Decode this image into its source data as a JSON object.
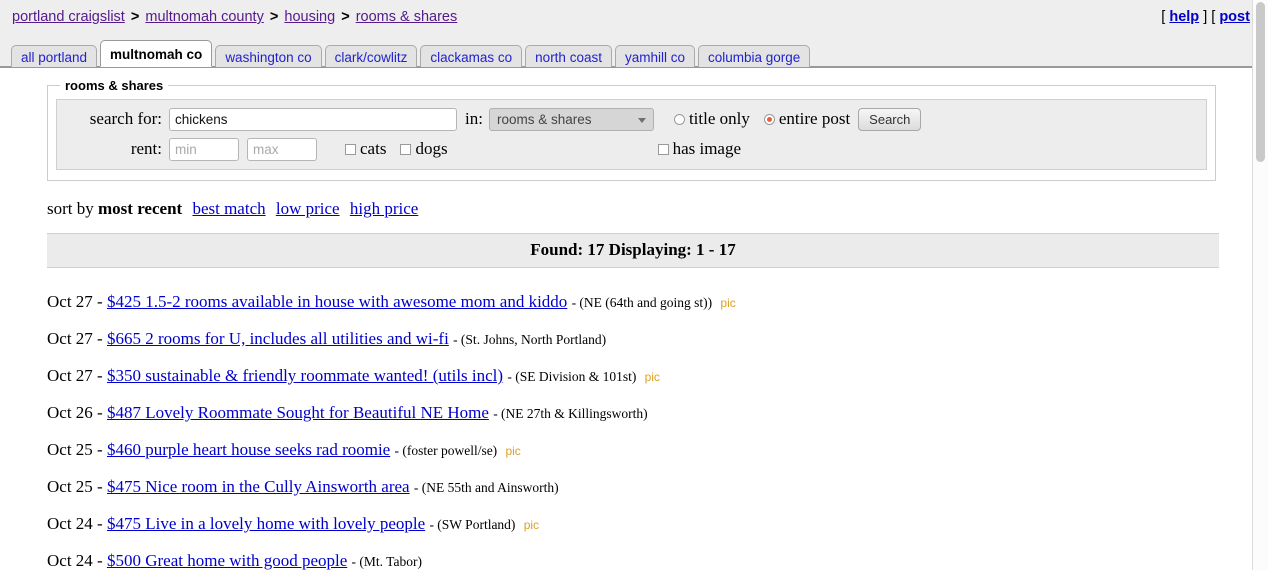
{
  "header": {
    "breadcrumb": [
      {
        "label": "portland craigslist"
      },
      {
        "label": "multnomah county"
      },
      {
        "label": "housing"
      },
      {
        "label": "rooms & shares"
      }
    ],
    "separator": ">",
    "links": {
      "open_bracket": "[",
      "close_bracket": "]",
      "help": "help",
      "post": "post"
    }
  },
  "tabs": [
    {
      "label": "all portland",
      "active": false
    },
    {
      "label": "multnomah co",
      "active": true
    },
    {
      "label": "washington co",
      "active": false
    },
    {
      "label": "clark/cowlitz",
      "active": false
    },
    {
      "label": "clackamas co",
      "active": false
    },
    {
      "label": "north coast",
      "active": false
    },
    {
      "label": "yamhill co",
      "active": false
    },
    {
      "label": "columbia gorge",
      "active": false
    }
  ],
  "search": {
    "legend": "rooms & shares",
    "search_for_label": "search for:",
    "query_value": "chickens",
    "in_label": "in:",
    "category_selected": "rooms & shares",
    "scope_title_only": "title only",
    "scope_entire_post": "entire post",
    "scope_selected": "entire post",
    "search_button": "Search",
    "rent_label": "rent:",
    "rent_min_placeholder": "min",
    "rent_max_placeholder": "max",
    "rent_min_value": "",
    "rent_max_value": "",
    "cats_label": "cats",
    "dogs_label": "dogs",
    "has_image_label": "has image"
  },
  "sort": {
    "prefix": "sort by",
    "current": "most recent",
    "options": [
      "best match",
      "low price",
      "high price"
    ]
  },
  "results": {
    "summary": "Found: 17 Displaying: 1 - 17",
    "items": [
      {
        "date": "Oct 27",
        "title": "$425 1.5-2 rooms available in house with awesome mom and kiddo",
        "location": "- (NE (64th and going st))",
        "pic": "pic"
      },
      {
        "date": "Oct 27",
        "title": "$665 2 rooms for U, includes all utilities and wi-fi",
        "location": "- (St. Johns, North Portland)",
        "pic": ""
      },
      {
        "date": "Oct 27",
        "title": "$350 sustainable & friendly roommate wanted! (utils incl)",
        "location": "- (SE Division & 101st)",
        "pic": "pic"
      },
      {
        "date": "Oct 26",
        "title": "$487 Lovely Roommate Sought for Beautiful NE Home",
        "location": "- (NE 27th & Killingsworth)",
        "pic": ""
      },
      {
        "date": "Oct 25",
        "title": "$460 purple heart house seeks rad roomie",
        "location": "- (foster powell/se)",
        "pic": "pic"
      },
      {
        "date": "Oct 25",
        "title": "$475 Nice room in the Cully Ainsworth area",
        "location": "- (NE 55th and Ainsworth)",
        "pic": ""
      },
      {
        "date": "Oct 24",
        "title": "$475 Live in a lovely home with lovely people",
        "location": "- (SW Portland)",
        "pic": "pic"
      },
      {
        "date": "Oct 24",
        "title": "$500 Great home with good people",
        "location": "- (Mt. Tabor)",
        "pic": ""
      }
    ],
    "date_separator": "-"
  },
  "colors": {
    "link": "#0000cc",
    "visited_link": "#551a8b",
    "pic_tag": "#e0a020",
    "radio_selected": "#e8603c",
    "header_bg": "#eeeeee"
  }
}
